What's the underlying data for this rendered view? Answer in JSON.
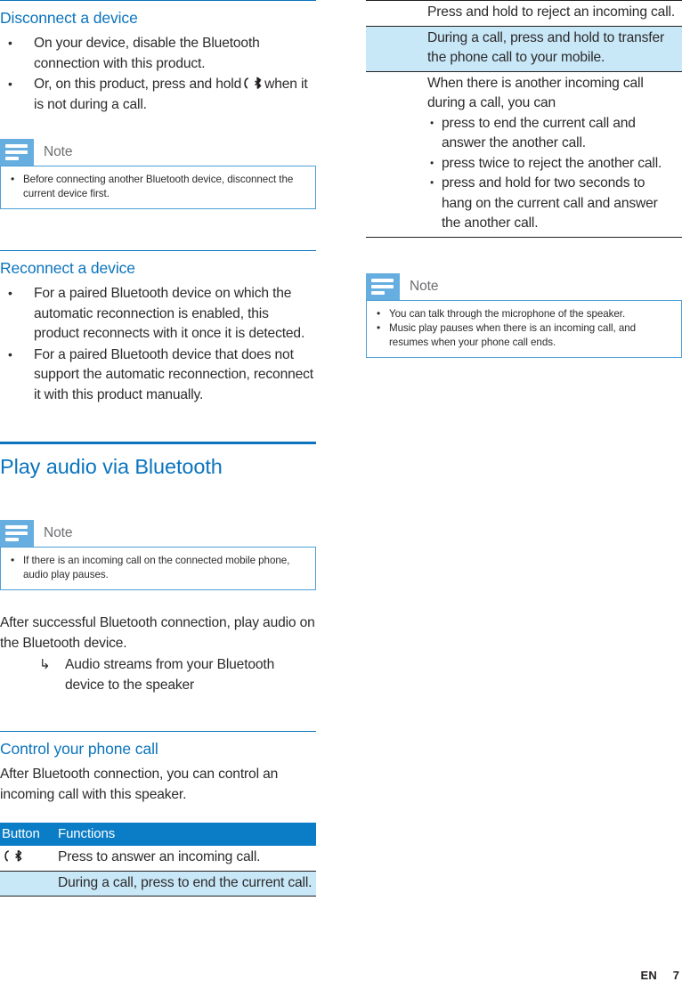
{
  "footer": {
    "language": "EN",
    "page_number": "7"
  },
  "icons": {
    "bt_phone": "phone-bluetooth-icon",
    "note": "note-lines-icon"
  },
  "colors": {
    "heading_blue": "#0b74bd",
    "table_header_blue": "#0b7cc6",
    "table_row_blue": "#c8e7f7",
    "note_icon_blue": "#66ade0",
    "note_border_blue": "#4da0d6"
  },
  "left_column": {
    "section_disconnect": {
      "title": "Disconnect a device",
      "bullets": [
        "On your device, disable the Bluetooth connection with this product.",
        "Or, on this product, press and hold %ICON% when it is not during a call."
      ],
      "bullet_1": "On your device, disable the Bluetooth connection with this product.",
      "bullet_2_before": "Or, on this product, press and hold",
      "bullet_2_after": "when it is not during a call."
    },
    "note_1": {
      "title": "Note",
      "items": [
        "Before connecting another Bluetooth device, disconnect the current device first."
      ]
    },
    "section_reconnect": {
      "title": "Reconnect a device",
      "bullets": [
        "For a paired Bluetooth device on which the automatic reconnection is enabled, this product reconnects with it once it is detected.",
        "For a paired Bluetooth device that does not support the automatic reconnection, reconnect it with this product manually."
      ]
    },
    "section_play_audio": {
      "title": "Play audio via Bluetooth"
    },
    "note_2": {
      "title": "Note",
      "items": [
        "If there is an incoming call on the connected mobile phone, audio play pauses."
      ]
    },
    "play_audio_body": {
      "paragraph": "After successful Bluetooth connection, play audio on the Bluetooth device.",
      "arrow_item": "Audio streams from your Bluetooth device to the speaker"
    },
    "section_control_call": {
      "title": "Control your phone call",
      "paragraph": "After Bluetooth connection, you can control an incoming call with this speaker."
    },
    "table": {
      "headers": {
        "col1": "Button",
        "col2": "Functions"
      },
      "rows": [
        {
          "button_icon": "phone-bluetooth-icon",
          "text": "Press to answer an incoming call.",
          "shade": "white"
        },
        {
          "button_icon": "",
          "text": "During a call, press to end the current call.",
          "shade": "blue"
        }
      ]
    }
  },
  "right_column": {
    "table_continued": {
      "rows": [
        {
          "text": "Press and hold to reject an incoming call.",
          "shade": "white"
        },
        {
          "text": "During a call, press and hold to transfer the phone call to your mobile.",
          "shade": "blue"
        },
        {
          "text": "When there is another incoming call during a call, you can",
          "shade": "white",
          "subitems": [
            "press to end the current call and answer the another call.",
            "press twice to reject the another call.",
            "press and hold for two seconds to hang on the current call and answer the another call."
          ]
        }
      ]
    },
    "note_3": {
      "title": "Note",
      "items": [
        "You can talk through the microphone of the speaker.",
        "Music play pauses when there is an incoming call, and resumes when your phone call ends."
      ]
    }
  }
}
